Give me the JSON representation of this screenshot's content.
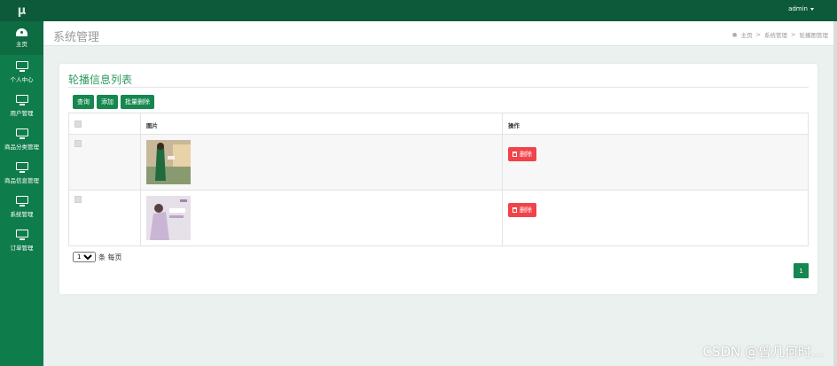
{
  "app": {
    "logo": "μ",
    "user": "admin"
  },
  "sidebar": {
    "items": [
      {
        "label": "主页",
        "icon": "dashboard-icon"
      },
      {
        "label": "个人中心",
        "icon": "monitor-icon"
      },
      {
        "label": "用户管理",
        "icon": "monitor-icon"
      },
      {
        "label": "商品分类管理",
        "icon": "monitor-icon"
      },
      {
        "label": "商品信息管理",
        "icon": "monitor-icon"
      },
      {
        "label": "系统管理",
        "icon": "monitor-icon"
      },
      {
        "label": "订单管理",
        "icon": "monitor-icon"
      }
    ]
  },
  "header": {
    "title": "系统管理",
    "breadcrumb": [
      "主页",
      "系统管理",
      "轮播图管理"
    ]
  },
  "card": {
    "title": "轮播信息列表",
    "buttons": {
      "query": "查询",
      "add": "添加",
      "batch_delete": "批量删除"
    },
    "table": {
      "headers": {
        "image": "图片",
        "action": "操作"
      },
      "rows": [
        {
          "image_alt": "banner-image-1",
          "delete_label": "删除"
        },
        {
          "image_alt": "banner-image-2",
          "delete_label": "删除"
        }
      ]
    },
    "pager": {
      "page_size": "10",
      "suffix": "条 每页",
      "current_page": "1"
    }
  },
  "watermark": "CSDN @曾几何时…",
  "colors": {
    "topbar": "#0c5a3a",
    "sidebar": "#0f7d4b",
    "accent": "#15874f",
    "danger": "#f0444a"
  }
}
